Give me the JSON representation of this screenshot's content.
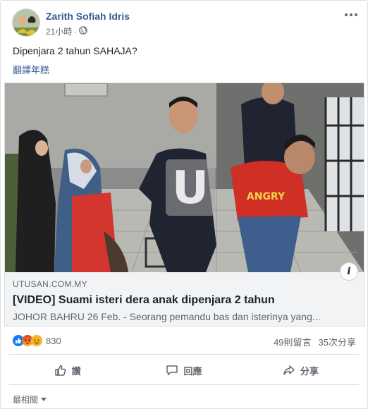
{
  "post": {
    "author": "Zarith Sofiah Idris",
    "time": "21小時",
    "separator": "·",
    "text": "Dipenjara 2 tahun SAHAJA?",
    "translate_label": "翻譯年糕"
  },
  "link_card": {
    "domain": "UTUSAN.COM.MY",
    "title": "[VIDEO] Suami isteri dera anak dipenjara 2 tahun",
    "description": "JOHOR BAHRU 26 Feb. - Seorang pemandu bas dan isterinya yang...",
    "info_label": "i",
    "watermark": "U"
  },
  "stats": {
    "reaction_count": "830",
    "comments": "49則留言",
    "shares": "35次分享",
    "reaction_icons": [
      "like-icon",
      "angry-icon",
      "sad-icon"
    ]
  },
  "actions": {
    "like": "讚",
    "comment": "回應",
    "share": "分享"
  },
  "sort": {
    "label": "最相關"
  },
  "colors": {
    "link_blue": "#385898",
    "text_gray": "#606770",
    "like_blue": "#1877f2",
    "angry_orange": "#e9710f",
    "sad_yellow": "#f7b125"
  }
}
